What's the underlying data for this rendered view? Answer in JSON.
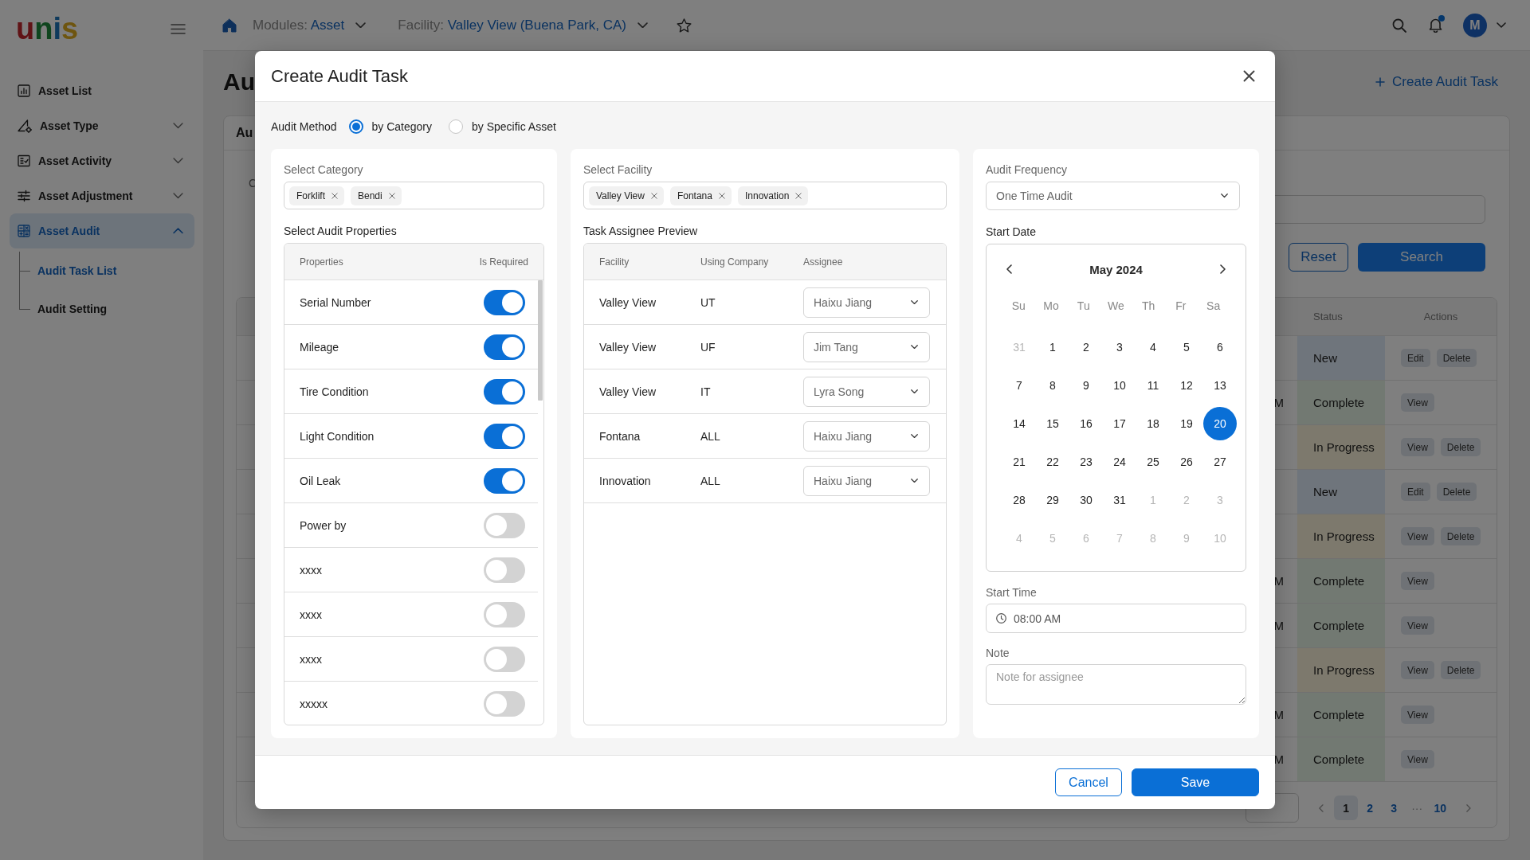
{
  "sidebar": {
    "logo": "unis",
    "items": [
      {
        "label": "Asset List",
        "kind": "link",
        "selected": false
      },
      {
        "label": "Asset Type",
        "kind": "group",
        "selected": false,
        "expanded": false
      },
      {
        "label": "Asset Activity",
        "kind": "group",
        "selected": false,
        "expanded": false
      },
      {
        "label": "Asset Adjustment",
        "kind": "group",
        "selected": false,
        "expanded": false
      },
      {
        "label": "Asset Audit",
        "kind": "group",
        "selected": true,
        "expanded": true,
        "children": [
          {
            "label": "Audit Task List",
            "selected": true
          },
          {
            "label": "Audit Setting",
            "selected": false
          }
        ]
      }
    ]
  },
  "header": {
    "module": {
      "label": "Modules:",
      "value": "Asset"
    },
    "facility": {
      "label": "Facility:",
      "value": "Valley View (Buena Park, CA)"
    },
    "starred": false,
    "unread": true,
    "avatar": "M"
  },
  "page": {
    "title": "Au",
    "create_button": "Create Audit Task",
    "card": {
      "tab": "Au",
      "filter_label": "C",
      "reset_button": "Reset",
      "search_button": "Search",
      "table": {
        "columns": [
          "Status",
          "Actions"
        ],
        "rows": [
          {
            "status": "New",
            "kind": "new",
            "actions": [
              "Edit",
              "Delete"
            ]
          },
          {
            "column_3": "M",
            "status": "Complete",
            "kind": "complete",
            "actions": [
              "View"
            ]
          },
          {
            "status": "In Progress",
            "kind": "in_progress",
            "actions": [
              "View",
              "Delete"
            ]
          },
          {
            "status": "New",
            "kind": "new",
            "actions": [
              "Edit",
              "Delete"
            ]
          },
          {
            "status": "In Progress",
            "kind": "in_progress",
            "actions": [
              "View",
              "Delete"
            ]
          },
          {
            "column_3": "M",
            "status": "Complete",
            "kind": "complete",
            "actions": [
              "View"
            ]
          },
          {
            "column_3": "M",
            "status": "Complete",
            "kind": "complete",
            "actions": [
              "View"
            ]
          },
          {
            "status": "In Progress",
            "kind": "in_progress",
            "actions": [
              "View",
              "Delete"
            ]
          },
          {
            "column_3": "M",
            "status": "Complete",
            "kind": "complete",
            "actions": [
              "View"
            ]
          },
          {
            "column_3": "M",
            "status": "Complete",
            "kind": "complete",
            "actions": [
              "View"
            ]
          }
        ]
      },
      "pagination": {
        "pages": [
          {
            "label": "1",
            "selected": true
          },
          {
            "label": "2",
            "selected": false
          },
          {
            "label": "3",
            "selected": false
          }
        ],
        "ellipsis": "···",
        "last_page": {
          "label": "10",
          "selected": false
        }
      }
    }
  },
  "modal": {
    "title": "Create Audit Task",
    "audit_method": {
      "label": "Audit Method",
      "options": [
        {
          "label": "by Category",
          "selected": true
        },
        {
          "label": "by Specific Asset",
          "selected": false
        }
      ]
    },
    "category": {
      "label": "Select Category",
      "tags": [
        "Forklift",
        "Bendi"
      ]
    },
    "properties": {
      "label": "Select Audit Properties",
      "columns": [
        "Properties",
        "Is Required"
      ],
      "rows": [
        {
          "name": "Serial Number",
          "required": true
        },
        {
          "name": "Mileage",
          "required": true
        },
        {
          "name": "Tire Condition",
          "required": true
        },
        {
          "name": "Light Condition",
          "required": true
        },
        {
          "name": "Oil Leak",
          "required": true
        },
        {
          "name": "Power by",
          "required": false
        },
        {
          "name": "xxxx",
          "required": false
        },
        {
          "name": "xxxx",
          "required": false
        },
        {
          "name": "xxxx",
          "required": false
        },
        {
          "name": "xxxxx",
          "required": false
        }
      ]
    },
    "facility": {
      "label": "Select Facility",
      "tags": [
        "Valley View",
        "Fontana",
        "Innovation"
      ]
    },
    "assignees": {
      "label": "Task Assignee Preview",
      "columns": [
        "Facility",
        "Using Company",
        "Assignee"
      ],
      "rows": [
        {
          "facility": "Valley View",
          "company": "UT",
          "assignee": "Haixu Jiang"
        },
        {
          "facility": "Valley View",
          "company": "UF",
          "assignee": "Jim Tang"
        },
        {
          "facility": "Valley View",
          "company": "IT",
          "assignee": "Lyra Song"
        },
        {
          "facility": "Fontana",
          "company": "ALL",
          "assignee": "Haixu Jiang"
        },
        {
          "facility": "Innovation",
          "company": "ALL",
          "assignee": "Haixu Jiang"
        }
      ]
    },
    "frequency": {
      "label": "Audit Frequency",
      "value": "One Time Audit"
    },
    "start_date": {
      "label": "Start Date",
      "month": "May 2024",
      "weekdays": [
        "Su",
        "Mo",
        "Tu",
        "We",
        "Th",
        "Fr",
        "Sa"
      ],
      "days": [
        {
          "label": "31",
          "outside": true,
          "selected": false
        },
        {
          "label": "1",
          "outside": false,
          "selected": false
        },
        {
          "label": "2",
          "outside": false,
          "selected": false
        },
        {
          "label": "3",
          "outside": false,
          "selected": false
        },
        {
          "label": "4",
          "outside": false,
          "selected": false
        },
        {
          "label": "5",
          "outside": false,
          "selected": false
        },
        {
          "label": "6",
          "outside": false,
          "selected": false
        },
        {
          "label": "7",
          "outside": false,
          "selected": false
        },
        {
          "label": "8",
          "outside": false,
          "selected": false
        },
        {
          "label": "9",
          "outside": false,
          "selected": false
        },
        {
          "label": "10",
          "outside": false,
          "selected": false
        },
        {
          "label": "11",
          "outside": false,
          "selected": false
        },
        {
          "label": "12",
          "outside": false,
          "selected": false
        },
        {
          "label": "13",
          "outside": false,
          "selected": false
        },
        {
          "label": "14",
          "outside": false,
          "selected": false
        },
        {
          "label": "15",
          "outside": false,
          "selected": false
        },
        {
          "label": "16",
          "outside": false,
          "selected": false
        },
        {
          "label": "17",
          "outside": false,
          "selected": false
        },
        {
          "label": "18",
          "outside": false,
          "selected": false
        },
        {
          "label": "19",
          "outside": false,
          "selected": false
        },
        {
          "label": "20",
          "outside": false,
          "selected": true
        },
        {
          "label": "21",
          "outside": false,
          "selected": false
        },
        {
          "label": "22",
          "outside": false,
          "selected": false
        },
        {
          "label": "23",
          "outside": false,
          "selected": false
        },
        {
          "label": "24",
          "outside": false,
          "selected": false
        },
        {
          "label": "25",
          "outside": false,
          "selected": false
        },
        {
          "label": "26",
          "outside": false,
          "selected": false
        },
        {
          "label": "27",
          "outside": false,
          "selected": false
        },
        {
          "label": "28",
          "outside": false,
          "selected": false
        },
        {
          "label": "29",
          "outside": false,
          "selected": false
        },
        {
          "label": "30",
          "outside": false,
          "selected": false
        },
        {
          "label": "31",
          "outside": false,
          "selected": false
        },
        {
          "label": "1",
          "outside": true,
          "selected": false
        },
        {
          "label": "2",
          "outside": true,
          "selected": false
        },
        {
          "label": "3",
          "outside": true,
          "selected": false
        },
        {
          "label": "4",
          "outside": true,
          "selected": false
        },
        {
          "label": "5",
          "outside": true,
          "selected": false
        },
        {
          "label": "6",
          "outside": true,
          "selected": false
        },
        {
          "label": "7",
          "outside": true,
          "selected": false
        },
        {
          "label": "8",
          "outside": true,
          "selected": false
        },
        {
          "label": "9",
          "outside": true,
          "selected": false
        },
        {
          "label": "10",
          "outside": true,
          "selected": false
        }
      ]
    },
    "start_time": {
      "label": "Start Time",
      "value": "08:00 AM"
    },
    "note": {
      "label": "Note",
      "placeholder": "Note for assignee"
    },
    "buttons": [
      {
        "label": "Cancel",
        "kind": "secondary"
      },
      {
        "label": "Save",
        "kind": "primary"
      }
    ]
  }
}
